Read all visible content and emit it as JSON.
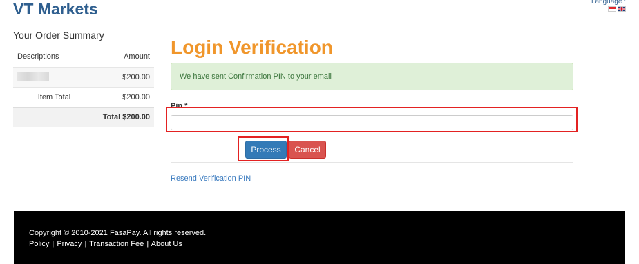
{
  "header": {
    "brand": "VT Markets",
    "language_label": "Language :",
    "flags": [
      "indonesia-flag-icon",
      "uk-flag-icon"
    ]
  },
  "summary": {
    "title": "Your Order Summary",
    "col_descriptions": "Descriptions",
    "col_amount": "Amount",
    "item_amount": "$200.00",
    "item_total_label": "Item Total",
    "item_total_value": "$200.00",
    "total_label": "Total $200.00"
  },
  "main": {
    "title": "Login Verification",
    "alert": "We have sent Confirmation PIN to your email",
    "pin_label": "Pin *",
    "pin_value": "",
    "process_label": "Process",
    "cancel_label": "Cancel",
    "resend_label": "Resend Verification PIN"
  },
  "footer": {
    "copyright": "Copyright © 2010-2021 FasaPay. All rights reserved.",
    "links": {
      "policy": "Policy",
      "privacy": "Privacy",
      "fee": "Transaction Fee",
      "about": "About Us"
    },
    "separator": "|"
  },
  "colors": {
    "brand": "#2f5f8f",
    "title_orange": "#f0962b",
    "alert_bg": "#dff0d8",
    "process_blue": "#337ab7",
    "cancel_red": "#d9534f",
    "highlight_red": "#e32222",
    "link_blue": "#3b7bbf"
  }
}
